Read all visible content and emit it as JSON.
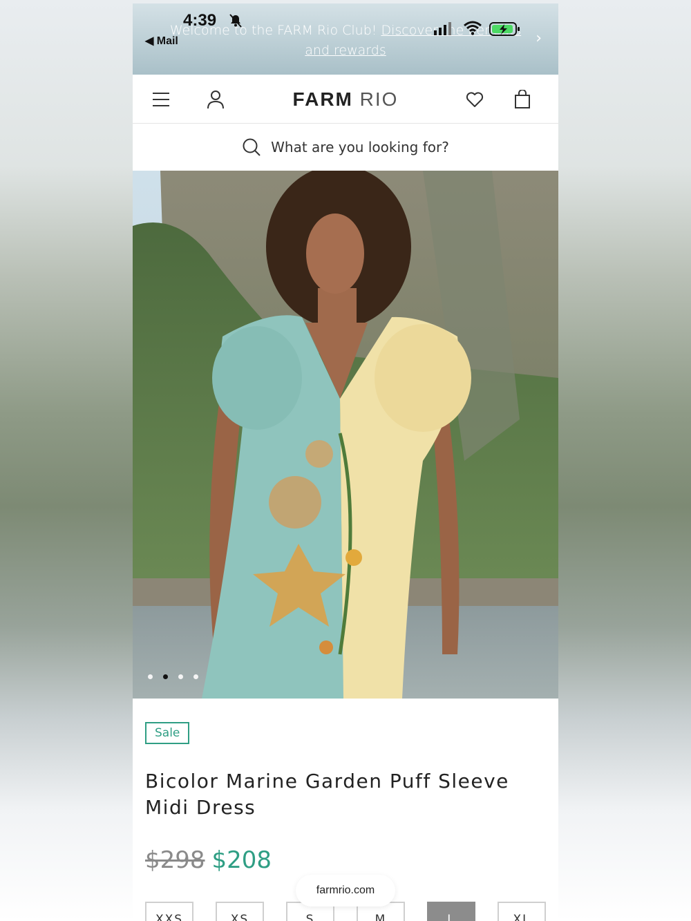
{
  "status_bar": {
    "time": "4:39",
    "back_label": "Mail"
  },
  "announcement": {
    "text": "Welcome to the FARM Rio Club!",
    "link": "Discover the benefits and rewards"
  },
  "header": {
    "brand_primary": "FARM",
    "brand_secondary": "RIO"
  },
  "search": {
    "placeholder": "What are you looking for?"
  },
  "gallery": {
    "slide_count": 4,
    "active_index": 1
  },
  "product": {
    "badge": "Sale",
    "title": "Bicolor Marine Garden Puff Sleeve Midi Dress",
    "original_price": "$298",
    "sale_price": "$208",
    "sizes": [
      "XXS",
      "XS",
      "S",
      "M",
      "L",
      "XL"
    ],
    "selected_size": "L"
  },
  "browser": {
    "url": "farmrio.com"
  },
  "colors": {
    "accent": "#2f9e84",
    "announcement_bg": "#a9c0c8"
  }
}
